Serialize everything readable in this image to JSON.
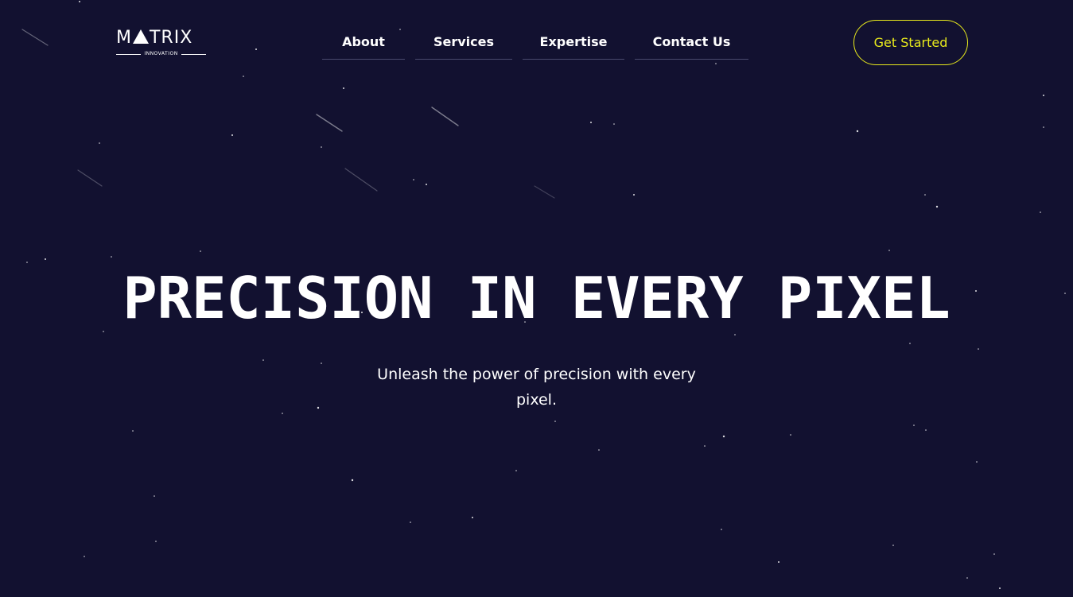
{
  "brand": {
    "logo_text_left": "M",
    "logo_text_right": "TRIX",
    "logo_subtitle": "INNOVATION"
  },
  "nav": {
    "items": [
      {
        "label": "About"
      },
      {
        "label": "Services"
      },
      {
        "label": "Expertise"
      },
      {
        "label": "Contact Us"
      }
    ]
  },
  "cta": {
    "label": "Get Started"
  },
  "hero": {
    "title": "PRECISION IN EVERY PIXEL",
    "subtitle": "Unleash the power of precision with every pixel."
  },
  "colors": {
    "background": "#121130",
    "accent": "#e8ea1c",
    "text": "#ffffff"
  }
}
